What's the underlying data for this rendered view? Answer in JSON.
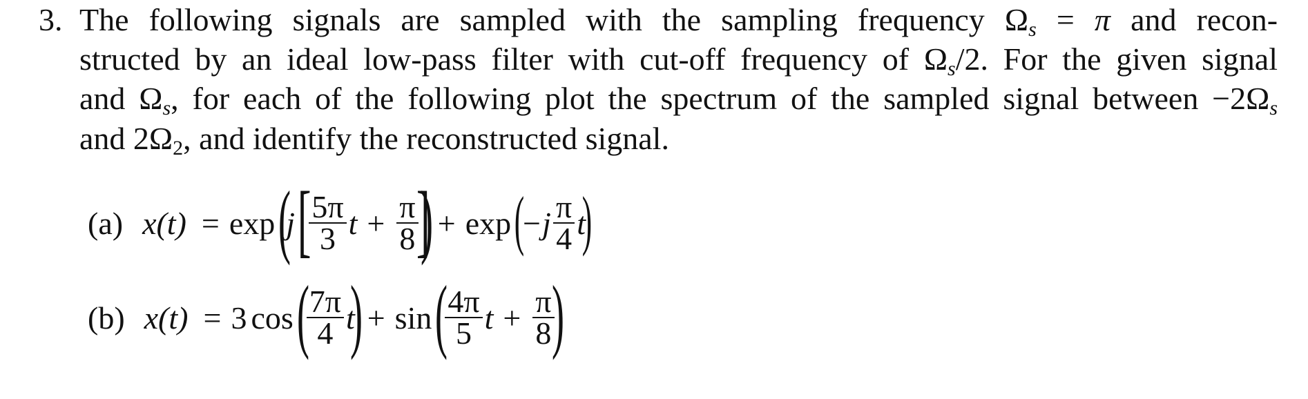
{
  "problem": {
    "number": "3.",
    "lines": {
      "l1_a": "The following signals are sampled with the sampling frequency",
      "l1_omega": "Ω",
      "l1_sub": "s",
      "l1_b": "=",
      "l1_pi": "π",
      "l1_c": "and recon-",
      "l2_a": "structed by an ideal low-pass filter with cut-off frequency of",
      "l2_omega": "Ω",
      "l2_sub": "s",
      "l2_b": "/2.  For the given signal",
      "l3_a": "and",
      "l3_omega": "Ω",
      "l3_sub": "s",
      "l3_b": ", for each of the following plot the spectrum of the sampled signal between −2",
      "l3_omega2": "Ω",
      "l3_sub2": "s",
      "l4_a": "and 2",
      "l4_omega": "Ω",
      "l4_sub": "2",
      "l4_b": ", and identify the reconstructed signal."
    }
  },
  "parts": [
    {
      "label": "(a)",
      "lhs": "x(t)",
      "equals": "=",
      "expression_text": "x(t) = exp( j [ 5π/3 t + π/8 ] ) + exp( −j π/4 t )",
      "tokens": {
        "exp1": "exp",
        "j": "j",
        "f1_num": "5π",
        "f1_den": "3",
        "t1": "t",
        "plus1": "+",
        "f2_num": "π",
        "f2_den": "8",
        "plus2": "+",
        "exp2": "exp",
        "neg_j": "−j",
        "f3_num": "π",
        "f3_den": "4",
        "t2": "t"
      }
    },
    {
      "label": "(b)",
      "lhs": "x(t)",
      "equals": "=",
      "expression_text": "x(t) = 3 cos( 7π/4 t ) + sin( 4π/5 t + π/8 )",
      "tokens": {
        "coef": "3",
        "cos": "cos",
        "f1_num": "7π",
        "f1_den": "4",
        "t1": "t",
        "plus1": "+",
        "sin": "sin",
        "f2_num": "4π",
        "f2_den": "5",
        "t2": "t",
        "plus2": "+",
        "f3_num": "π",
        "f3_den": "8"
      }
    }
  ]
}
